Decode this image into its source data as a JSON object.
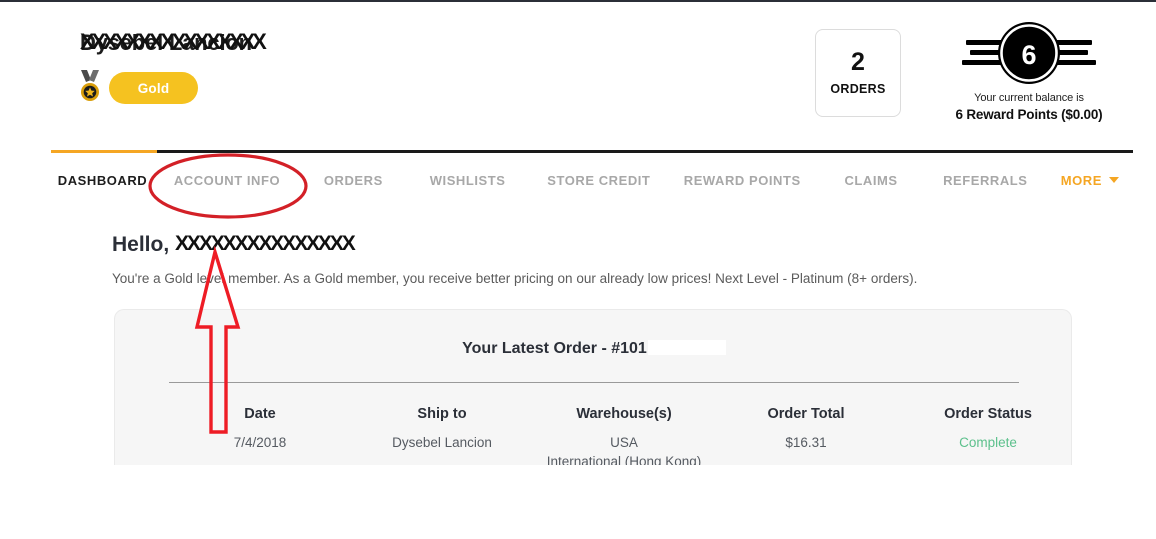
{
  "header": {
    "account_name_redacted": "Dysebel Lancion",
    "redaction_overlay": "XXXXXXXXXXXXXXXX",
    "tier_label": "Gold",
    "medal_icon": "medal-icon",
    "orders": {
      "count": "2",
      "label": "ORDERS"
    },
    "reward": {
      "points_badge": "6",
      "balance_prefix": "Your current balance is",
      "balance_value": "6 Reward Points ($0.00)",
      "badge_icon": "reward-wings-badge-icon"
    }
  },
  "nav": {
    "tabs": [
      {
        "label": "DASHBOARD",
        "active": true
      },
      {
        "label": "ACCOUNT INFO",
        "active": false
      },
      {
        "label": "ORDERS",
        "active": false
      },
      {
        "label": "WISHLISTS",
        "active": false
      },
      {
        "label": "STORE CREDIT",
        "active": false
      },
      {
        "label": "REWARD POINTS",
        "active": false
      },
      {
        "label": "CLAIMS",
        "active": false
      },
      {
        "label": "REFERRALS",
        "active": false
      },
      {
        "label": "MORE",
        "active": false
      }
    ],
    "active_accent": "#f5a623",
    "caret_icon": "chevron-down-icon"
  },
  "greeting": {
    "hello_prefix": "Hello,",
    "name_redaction": "XXXXXXXXXXXXXXX",
    "subtitle": "You're a Gold level member. As a Gold member, you receive better pricing on our already low prices! Next Level - Platinum (8+ orders)."
  },
  "latest_order": {
    "title_prefix": "Your Latest Order - #101",
    "columns": [
      "Date",
      "Ship to",
      "Warehouse(s)",
      "Order Total",
      "Order Status"
    ],
    "values": {
      "date": "7/4/2018",
      "ship_to": "Dysebel Lancion",
      "warehouse_line1": "USA",
      "warehouse_line2": "International (Hong Kong)",
      "order_total": "$16.31",
      "order_status": "Complete"
    },
    "status_color": "#5cc08c"
  },
  "annotations": {
    "ellipse_target": "ACCOUNT INFO",
    "arrow_color": "#ee1c25",
    "ellipse_color": "#d32027"
  }
}
